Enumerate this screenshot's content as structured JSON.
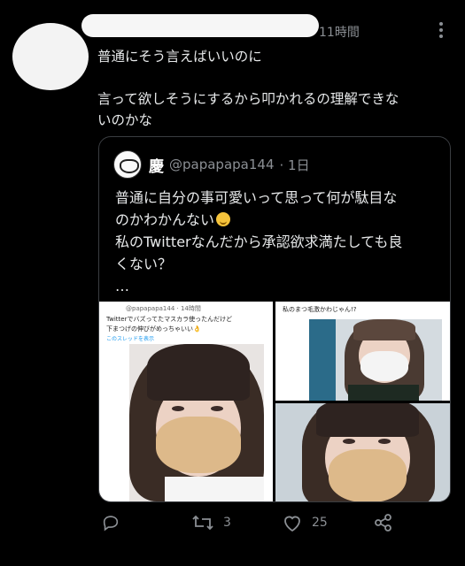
{
  "tweet": {
    "timestamp": "11時間",
    "lines": [
      "普通にそう言えばいいのに",
      "",
      "言って欲しそうにするから叩かれるの理解できな",
      "いのかな"
    ]
  },
  "quote": {
    "name": "慶",
    "handle": "@papapapa144",
    "time": "· 1日",
    "lines": [
      "普通に自分の事可愛いって思って何が駄目な",
      "のかわかんない",
      "私のTwitterなんだから承認欲求満たしても良",
      "くない？",
      "…"
    ],
    "emoji_name": "smiling-face-with-tear",
    "media": {
      "m1_handle": "@papapapa144 · 14時間",
      "m1_caption_line1": "Twitterでバズってたマスカラ使ったんだけど",
      "m1_caption_line2": "下まつげの伸びがめっちゃいい👌",
      "m1_link": "このスレッドを表示",
      "m2_caption": "私のまつ毛激かわじゃん!?"
    }
  },
  "actions": {
    "reply_count": "",
    "retweet_count": "3",
    "like_count": "25"
  },
  "colors": {
    "background": "#000000",
    "text": "#e7e9ea",
    "muted": "#8b8f94",
    "border": "#3a3d41",
    "link": "#1d9bf0"
  }
}
